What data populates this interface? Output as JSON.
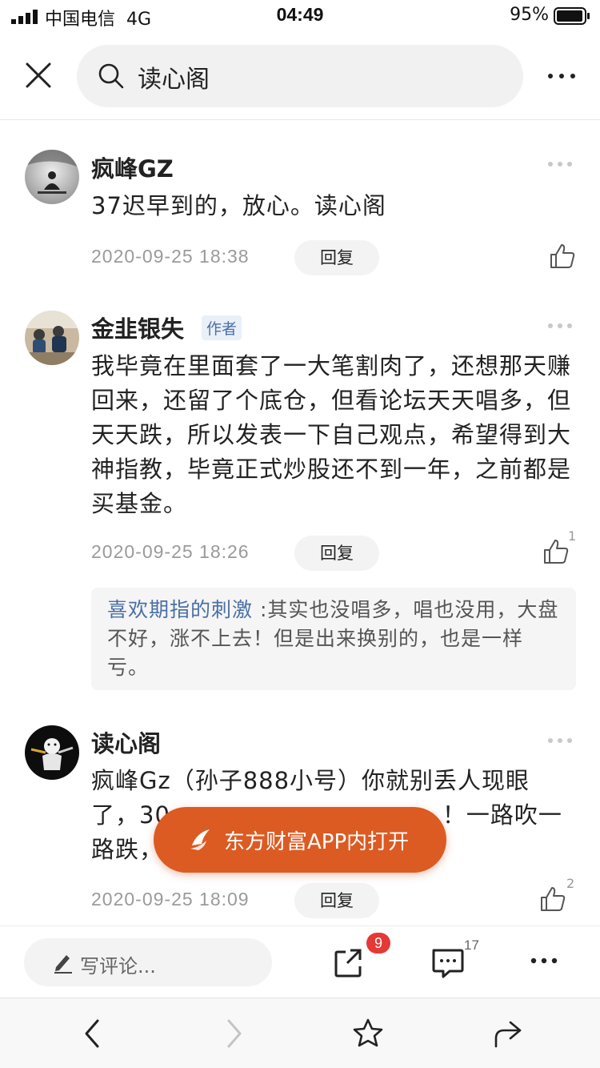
{
  "status_bar": {
    "carrier": "中国电信",
    "network": "4G",
    "time": "04:49",
    "battery_percent": "95%"
  },
  "search": {
    "query": "读心阁"
  },
  "comments": [
    {
      "name": "疯峰GZ",
      "text": "37迟早到的，放心。读心阁",
      "time": "2020-09-25 18:38",
      "reply_label": "回复",
      "likes": ""
    },
    {
      "name": "金韭银失",
      "author_tag": "作者",
      "text": "我毕竟在里面套了一大笔割肉了，还想那天赚回来，还留了个底仓，但看论坛天天唱多，但天天跌，所以发表一下自己观点，希望得到大神指教，毕竟正式炒股还不到一年，之前都是买基金。",
      "time": "2020-09-25 18:26",
      "reply_label": "回复",
      "likes": "1",
      "quote": {
        "user": "喜欢期指的刺激",
        "text": ":其实也没唱多，唱也没用，大盘不好，涨不上去！但是出来换别的，也是一样亏。"
      }
    },
    {
      "name": "读心阁",
      "text_line1": "疯峰Gz（孙子888小号）你就别丢人现眼",
      "text_line2_start": "了，30",
      "text_line2_end": "！一路吹一",
      "text_line3_start": "路跌，",
      "time": "2020-09-25 18:09",
      "reply_label": "回复",
      "likes": "2"
    }
  ],
  "open_app_button": "东方财富APP内打开",
  "action_bar": {
    "comment_placeholder": "写评论...",
    "share_badge": "9",
    "comment_count": "17"
  },
  "colors": {
    "accent_orange": "#dc5b23",
    "link_blue": "#4a6fa5",
    "badge_red": "#e53935"
  }
}
